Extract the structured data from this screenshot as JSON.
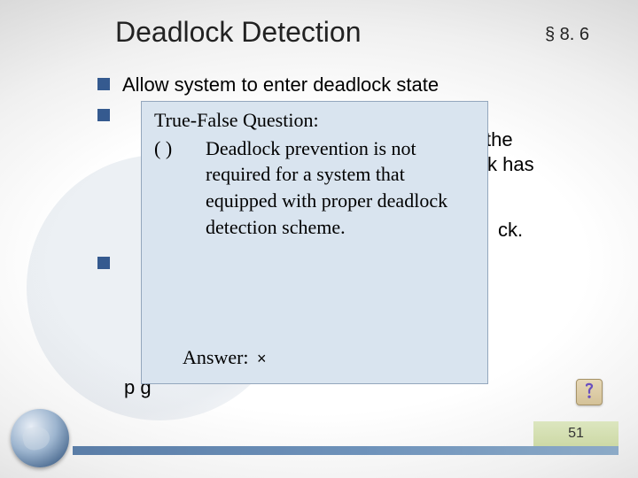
{
  "header": {
    "title": "Deadlock Detection",
    "section_ref": "§ 8. 6"
  },
  "bullets": {
    "b1": "Allow system to enter deadlock state"
  },
  "behind_fragments": {
    "the": "the",
    "k_has": "k has",
    "ck": "ck.",
    "bottom": "p                                                g"
  },
  "question": {
    "heading": "True-False Question:",
    "paren": "(     )",
    "line1": "Deadlock prevention is not",
    "line2": "required for a system that",
    "line3": "equipped with proper deadlock",
    "line4": "detection scheme.",
    "answer_label": "Answer:",
    "answer_mark": "×"
  },
  "footer": {
    "page_number": "51"
  },
  "icons": {
    "help": "help-icon",
    "globe": "globe-icon",
    "bullet": "square-bullet-icon"
  }
}
